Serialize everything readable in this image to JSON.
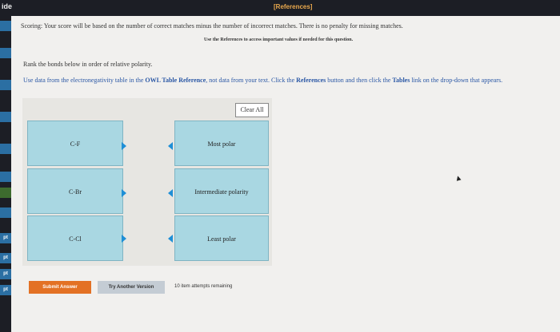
{
  "topbar": {
    "side_label": "ide",
    "references": "[References]"
  },
  "sidebar_tabs": [
    "",
    "",
    "",
    "",
    "",
    "",
    "",
    "",
    "pt",
    "pt",
    "pt",
    "pt"
  ],
  "scoring_text": "Scoring: Your score will be based on the number of correct matches minus the number of incorrect matches. There is no penalty for missing matches.",
  "use_refs_text": "Use the References to access important values if needed for this question.",
  "rank_prompt": "Rank the bonds below in order of relative polarity.",
  "instruction": {
    "part1": "Use data from the electronegativity table in the ",
    "owl": "OWL Table Reference",
    "part2": ", not data from your text. Click the ",
    "refs": "References",
    "part3": " button and then click the ",
    "tables": "Tables",
    "part4": " link on the drop-down that appears."
  },
  "clear_all": "Clear All",
  "bonds": [
    "C-F",
    "C-Br",
    "C-Cl"
  ],
  "ranks": [
    "Most polar",
    "Intermediate polarity",
    "Least polar"
  ],
  "buttons": {
    "submit": "Submit Answer",
    "try_another": "Try Another Version"
  },
  "attempts": "10 item attempts remaining"
}
